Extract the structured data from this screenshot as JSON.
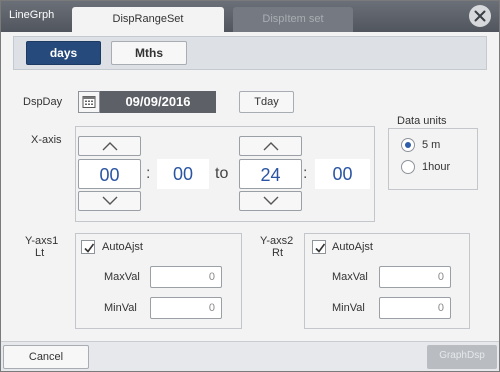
{
  "window": {
    "title": "LineGrph"
  },
  "tabs": [
    {
      "label": "DispRangeSet",
      "active": true
    },
    {
      "label": "DispItem set",
      "active": false
    }
  ],
  "unit_toggle": {
    "days": "days",
    "months": "Mths",
    "selected": "days"
  },
  "display_day": {
    "label": "DspDay",
    "date": "09/09/2016",
    "today_button": "Tday"
  },
  "x_axis": {
    "label": "X-axis",
    "start_hour": "00",
    "start_minute": "00",
    "to_label": "to",
    "end_hour": "24",
    "end_minute": "00",
    "separator": ":"
  },
  "data_units": {
    "label": "Data units",
    "options": [
      {
        "label": "5 m",
        "checked": true
      },
      {
        "label": "1hour",
        "checked": false
      }
    ]
  },
  "y_axis_left": {
    "label_line1": "Y-axs1",
    "label_line2": "Lt",
    "auto_adjust": "AutoAjst",
    "auto_checked": true,
    "max_label": "MaxVal",
    "max_value": "0",
    "min_label": "MinVal",
    "min_value": "0"
  },
  "y_axis_right": {
    "label_line1": "Y-axs2",
    "label_line2": "Rt",
    "auto_adjust": "AutoAjst",
    "auto_checked": true,
    "max_label": "MaxVal",
    "max_value": "0",
    "min_label": "MinVal",
    "min_value": "0"
  },
  "footer": {
    "cancel": "Cancel",
    "graph_display": "GraphDsp"
  },
  "colors": {
    "accent": "#274a7c",
    "time_text": "#2a55a3",
    "titlebar": "#5c6169",
    "date_field": "#5d6167"
  }
}
